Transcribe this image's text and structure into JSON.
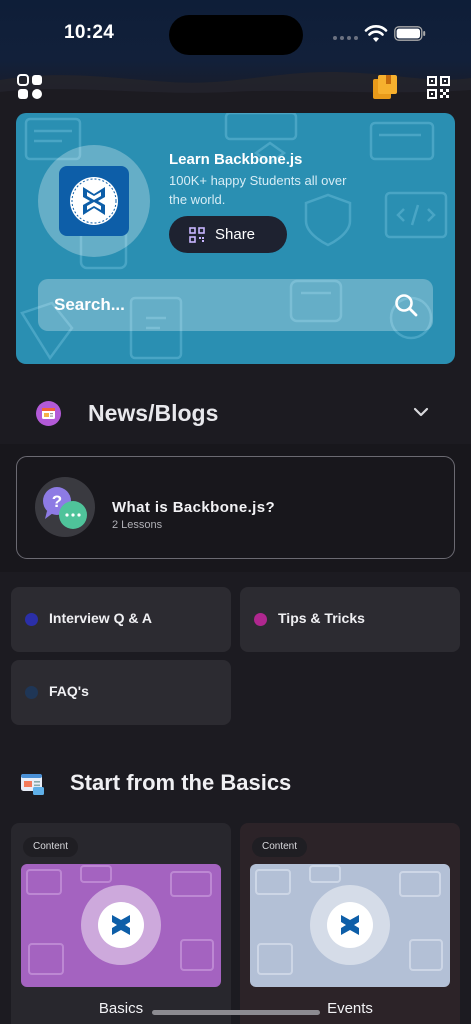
{
  "status_bar": {
    "time": "10:24"
  },
  "hero": {
    "title": "Learn Backbone.js",
    "subtitle": "100K+ happy Students all over the world.",
    "share_label": "Share",
    "search_placeholder": "Search..."
  },
  "news": {
    "label": "News/Blogs",
    "lesson": {
      "title": "What is Backbone.js?",
      "subtitle": "2 Lessons"
    }
  },
  "quick_links": [
    {
      "label": "Interview Q & A",
      "dot_color": "#2b2fa8"
    },
    {
      "label": "Tips & Tricks",
      "dot_color": "#b0278f"
    },
    {
      "label": "FAQ's",
      "dot_color": "#1f3656"
    }
  ],
  "basics": {
    "title": "Start from the Basics",
    "courses": [
      {
        "badge": "Content",
        "name": "Basics",
        "color": "#a463c0"
      },
      {
        "badge": "Content",
        "name": "Events",
        "color": "#b3c0d6"
      }
    ]
  },
  "icons": [
    "grid-icon",
    "book-icon",
    "qr-code-icon",
    "qr-share-icon",
    "search-icon",
    "newspaper-icon",
    "chevron-down-icon",
    "faq-chat-icon",
    "basics-icon",
    "backbone-logo-icon"
  ]
}
